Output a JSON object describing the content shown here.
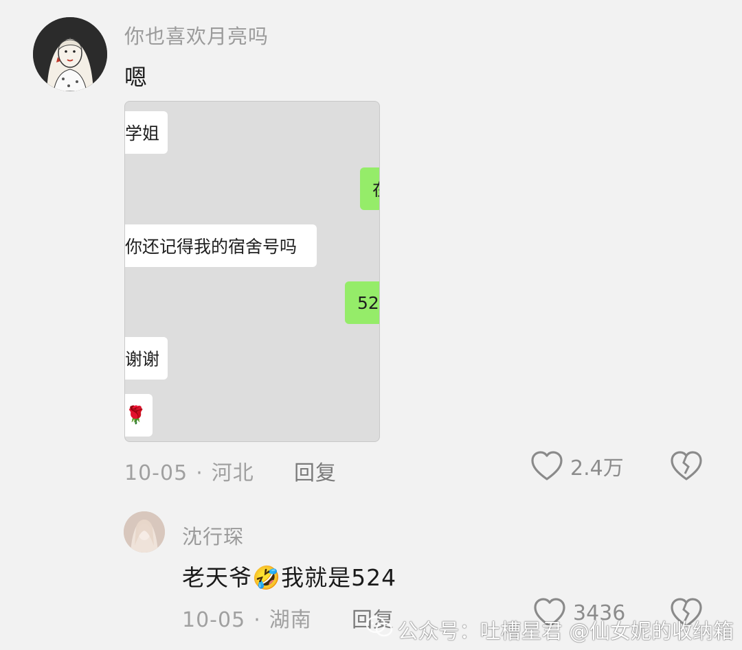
{
  "comment_main": {
    "username": "你也喜欢月亮吗",
    "text": "嗯",
    "date": "10-05",
    "separator": "·",
    "location": "河北",
    "reply_label": "回复",
    "like_count": "2.4万"
  },
  "chat_screenshot": {
    "messages": [
      {
        "side": "left",
        "text": "学姐"
      },
      {
        "side": "right",
        "text": "在"
      },
      {
        "side": "left",
        "text": "你还记得我的宿舍号吗"
      },
      {
        "side": "right",
        "text": "52"
      },
      {
        "side": "left",
        "text": "谢谢"
      },
      {
        "side": "left",
        "text": "🌹"
      }
    ]
  },
  "comment_reply": {
    "username": "沈行琛",
    "text": "老天爷🤣我就是524",
    "date": "10-05",
    "separator": "·",
    "location": "湖南",
    "reply_label": "回复",
    "like_count": "3436"
  },
  "watermark": {
    "text": "公众号：吐槽星君  @仙女妮的收纳箱"
  },
  "colors": {
    "background": "#f2f2f2",
    "bubble_green": "#95ec69",
    "bubble_white": "#ffffff",
    "meta_gray": "#a0a0a0"
  }
}
